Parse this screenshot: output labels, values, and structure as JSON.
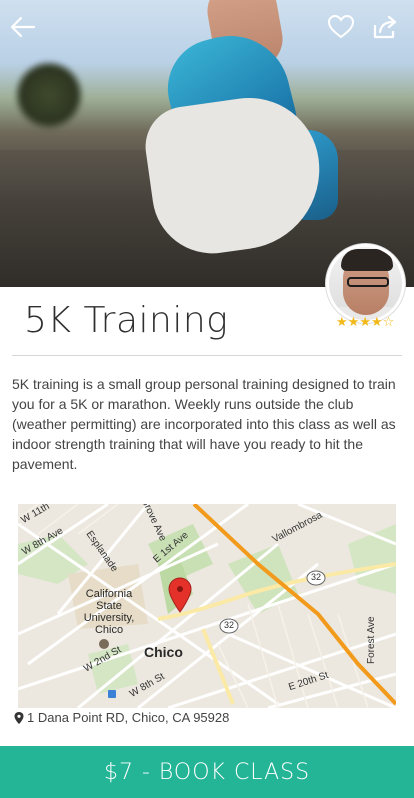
{
  "header": {
    "back_icon": "arrow-left-icon",
    "favorite_icon": "heart-outline-icon",
    "share_icon": "share-icon"
  },
  "class": {
    "title": "5K Training",
    "rating": 4,
    "rating_max": 5,
    "description": "5K training is a small group personal training designed to train you for a 5K or marathon. Weekly runs outside the club (weather permitting) are incorporated into this class as well as indoor strength training that will have you ready to hit the pavement."
  },
  "map": {
    "labels": {
      "w11th": "W 11th",
      "w8th": "W 8th Ave",
      "esplanade": "Esplanade",
      "grove": "Grove Ave",
      "e1st": "E 1st Ave",
      "vallombrosa": "Vallombrosa",
      "route32a": "32",
      "route32b": "32",
      "csu": "California State University, Chico",
      "chico": "Chico",
      "w2nd": "W 2nd St",
      "w8thst": "W 8th St",
      "e20th": "E 20th St",
      "forest": "Forest Ave"
    }
  },
  "address": "1 Dana Point RD, Chico, CA 95928",
  "book_button": "$7 - BOOK CLASS",
  "colors": {
    "accent": "#24b597",
    "star": "#f1b91a",
    "highway": "#f29a1b"
  }
}
